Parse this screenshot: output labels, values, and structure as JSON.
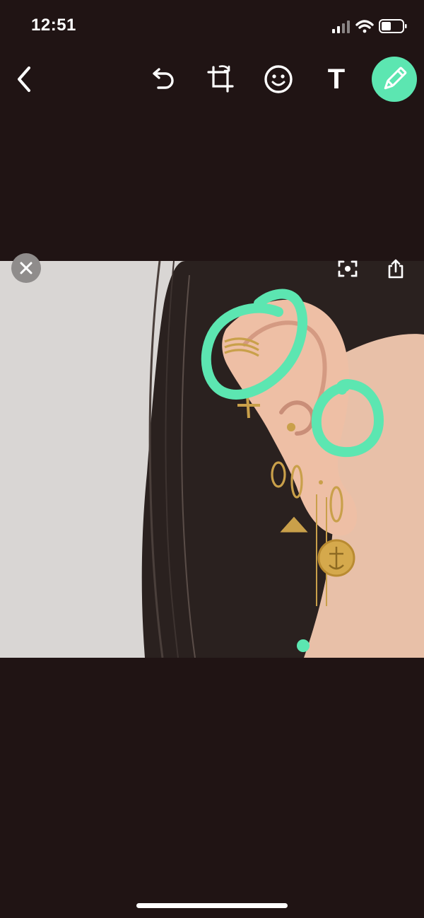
{
  "status_bar": {
    "time": "12:51",
    "icons": [
      "cellular-signal-icon",
      "wifi-icon",
      "battery-icon"
    ]
  },
  "toolbar": {
    "buttons": [
      "back-icon",
      "undo-icon",
      "crop-rotate-icon",
      "emoji-icon",
      "text-tool",
      "pencil-icon"
    ],
    "text_tool_label": "T"
  },
  "image_overlay": {
    "icons": [
      "close-icon",
      "scan-icon",
      "share-icon"
    ]
  },
  "colors": {
    "background": "#201414",
    "accent": "#5ce6b1",
    "icon": "#ffffff"
  }
}
